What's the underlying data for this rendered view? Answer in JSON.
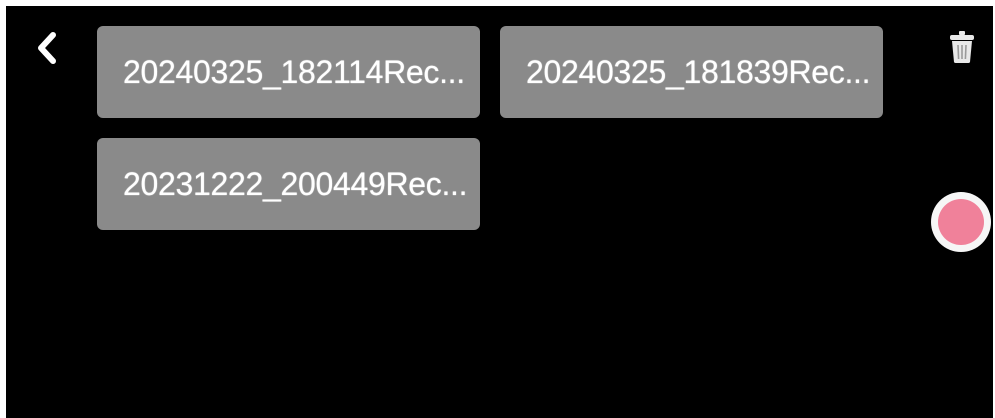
{
  "header": {
    "back_icon": "chevron-left-icon",
    "trash_icon": "trash-icon"
  },
  "files": [
    {
      "name": "20240325_182114Rec..."
    },
    {
      "name": "20240325_181839Rec..."
    },
    {
      "name": "20231222_200449Rec..."
    }
  ],
  "record": {
    "icon": "record-icon"
  },
  "colors": {
    "background": "#000000",
    "tile": "#8a8a8a",
    "record_ring": "#f6f6f6",
    "record_dot": "#f0819a",
    "text": "#ffffff"
  }
}
